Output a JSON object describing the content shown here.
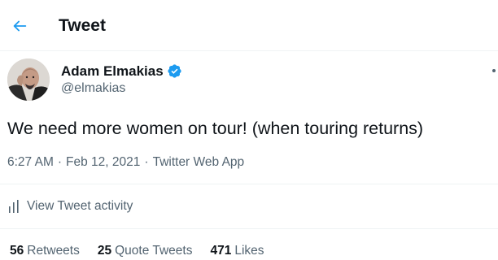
{
  "header": {
    "title": "Tweet",
    "back_icon": "arrow-left-icon"
  },
  "author": {
    "display_name": "Adam Elmakias",
    "handle": "@elmakias",
    "verified_icon": "verified-badge-icon"
  },
  "tweet": {
    "text": "We need more women on tour! (when touring returns)"
  },
  "meta": {
    "time": "6:27 AM",
    "separator": "·",
    "date": "Feb 12, 2021",
    "source": "Twitter Web App"
  },
  "activity": {
    "label": "View Tweet activity",
    "icon": "bar-chart-icon"
  },
  "stats": {
    "retweets_count": "56",
    "retweets_label": "Retweets",
    "quotes_count": "25",
    "quotes_label": "Quote Tweets",
    "likes_count": "471",
    "likes_label": "Likes"
  },
  "colors": {
    "accent": "#1d9bf0",
    "text_primary": "#0f1419",
    "text_secondary": "#536471",
    "divider": "#eff3f4"
  }
}
